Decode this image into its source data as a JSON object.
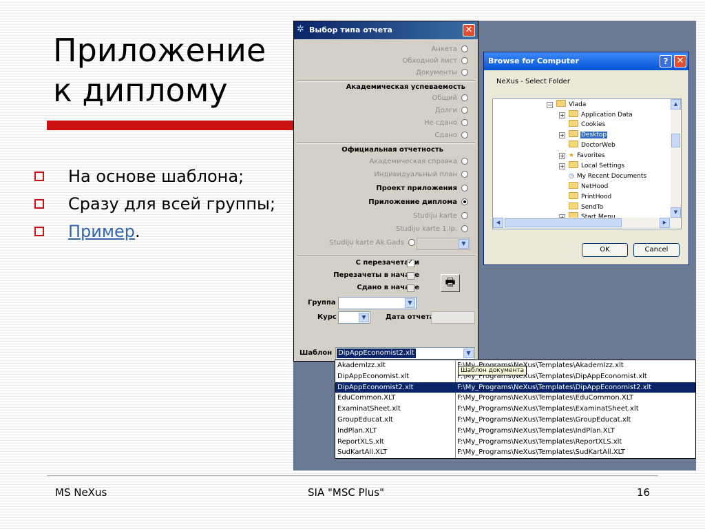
{
  "slide": {
    "title_line1": "Приложение",
    "title_line2": "к диплому",
    "bullets": [
      "На основе шаблона;",
      "Сразу для всей группы;"
    ],
    "bullet_link": "Пример",
    "bullet_link_suffix": ".",
    "footer_left": "MS NeXus",
    "footer_center": "SIA \"MSC Plus\"",
    "footer_right": "16",
    "accent_color": "#cc1111"
  },
  "report_dialog": {
    "title": "Выбор типа отчета",
    "close_glyph": "✕",
    "top_options": [
      "Анкета",
      "Обходной лист",
      "Документы"
    ],
    "academic_header": "Академическая успеваемость",
    "academic_options": [
      "Общий",
      "Долги",
      "Не сдано",
      "Сдано"
    ],
    "official_header": "Официальная отчетность",
    "official_options": [
      {
        "label": "Академическая справка",
        "enabled": false,
        "selected": false
      },
      {
        "label": "Индивидуальный план",
        "enabled": false,
        "selected": false
      },
      {
        "label": "Проект приложения",
        "enabled": true,
        "selected": false
      },
      {
        "label": "Приложение диплома",
        "enabled": true,
        "selected": true
      },
      {
        "label": "Studiju karte",
        "enabled": false,
        "selected": false
      },
      {
        "label": "Studiju karte 1.lp.",
        "enabled": false,
        "selected": false
      },
      {
        "label": "Studiju karte Ak.Gads",
        "enabled": false,
        "selected": false
      }
    ],
    "checks": [
      {
        "label": "С перезачетами",
        "checked": true,
        "enabled": true
      },
      {
        "label": "Перезачеты в начале",
        "checked": false,
        "enabled": false
      },
      {
        "label": "Сдано в начале",
        "checked": false,
        "enabled": false
      }
    ],
    "group_label": "Группа",
    "course_label": "Курс",
    "date_label": "Дата отчета",
    "template_label": "Шаблон",
    "template_value": "DipAppEconomist2.xlt",
    "print_icon": "printer-icon"
  },
  "template_list": {
    "items": [
      {
        "name": "AkademIzz.xlt",
        "path": "F:\\My_Programs\\NeXus\\Templates\\AkademIzz.xlt"
      },
      {
        "name": "DipAppEconomist.xlt",
        "path": "F:\\My_Programs\\NeXus\\Templates\\DipAppEconomist.xlt"
      },
      {
        "name": "DipAppEconomist2.xlt",
        "path": "F:\\My_Programs\\NeXus\\Templates\\DipAppEconomist2.xlt"
      },
      {
        "name": "EduCommon.XLT",
        "path": "F:\\My_Programs\\NeXus\\Templates\\EduCommon.XLT"
      },
      {
        "name": "ExaminatSheet.xlt",
        "path": "F:\\My_Programs\\NeXus\\Templates\\ExaminatSheet.xlt"
      },
      {
        "name": "GroupEducat.xlt",
        "path": "F:\\My_Programs\\NeXus\\Templates\\GroupEducat.xlt"
      },
      {
        "name": "IndPlan.XLT",
        "path": "F:\\My_Programs\\NeXus\\Templates\\IndPlan.XLT"
      },
      {
        "name": "ReportXLS.xlt",
        "path": "F:\\My_Programs\\NeXus\\Templates\\ReportXLS.xlt"
      },
      {
        "name": "SudKartAll.XLT",
        "path": "F:\\My_Programs\\NeXus\\Templates\\SudKartAll.XLT"
      }
    ],
    "selected_index": 2,
    "tooltip": "Шаблон документа"
  },
  "browse_dialog": {
    "title": "Browse for Computer",
    "help_glyph": "?",
    "close_glyph": "✕",
    "message": "NeXus   - Select Folder",
    "tree": [
      {
        "label": "Vlada",
        "level": 0,
        "expander": "−"
      },
      {
        "label": "Application Data",
        "level": 1,
        "expander": "+"
      },
      {
        "label": "Cookies",
        "level": 1,
        "expander": ""
      },
      {
        "label": "Desktop",
        "level": 1,
        "expander": "+",
        "selected": true
      },
      {
        "label": "DoctorWeb",
        "level": 1,
        "expander": ""
      },
      {
        "label": "Favorites",
        "level": 1,
        "expander": "+"
      },
      {
        "label": "Local Settings",
        "level": 1,
        "expander": "+"
      },
      {
        "label": "My Recent Documents",
        "level": 1,
        "expander": ""
      },
      {
        "label": "NetHood",
        "level": 1,
        "expander": ""
      },
      {
        "label": "PrintHood",
        "level": 1,
        "expander": ""
      },
      {
        "label": "SendTo",
        "level": 1,
        "expander": ""
      },
      {
        "label": "Start Menu",
        "level": 1,
        "expander": "+"
      }
    ],
    "ok_label": "OK",
    "cancel_label": "Cancel"
  }
}
